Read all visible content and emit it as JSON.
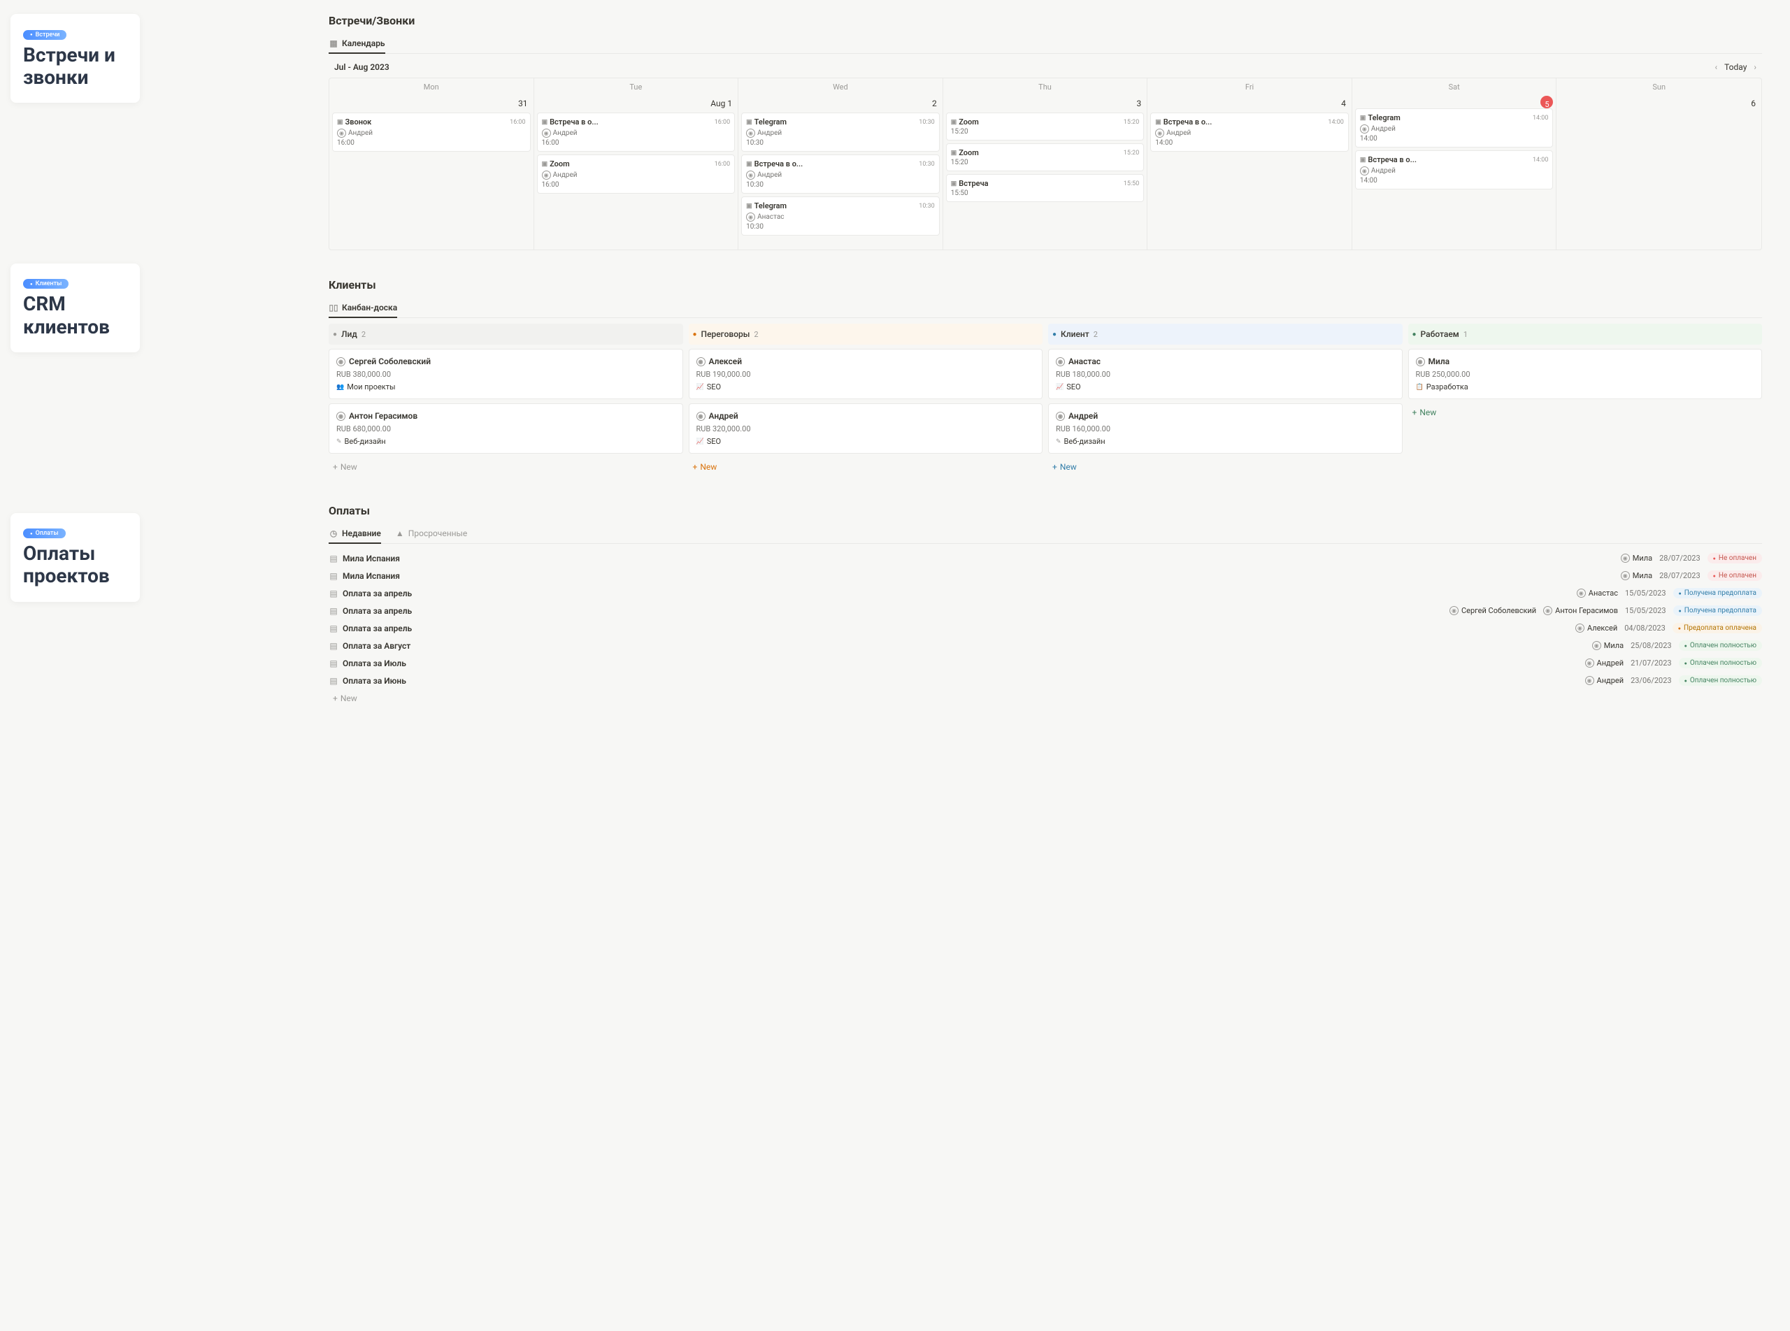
{
  "sidebar": [
    {
      "pill": "Встречи",
      "title": "Встречи и звонки"
    },
    {
      "pill": "Клиенты",
      "title": "CRM клиентов"
    },
    {
      "pill": "Оплаты",
      "title": "Оплаты проектов"
    }
  ],
  "meetings": {
    "title": "Встречи/Звонки",
    "tab": "Календарь",
    "month": "Jul - Aug 2023",
    "today": "Today",
    "days": [
      "Mon",
      "Tue",
      "Wed",
      "Thu",
      "Fri",
      "Sat",
      "Sun"
    ],
    "dates": [
      "31",
      "Aug 1",
      "2",
      "3",
      "4",
      "5",
      "6"
    ],
    "events": [
      [
        {
          "title": "Звонок",
          "topTime": "16:00",
          "person": "Андрей",
          "time": "16:00"
        }
      ],
      [
        {
          "title": "Встреча в о...",
          "topTime": "16:00",
          "person": "Андрей",
          "time": "16:00"
        },
        {
          "title": "Zoom",
          "topTime": "16:00",
          "person": "Андрей",
          "time": "16:00"
        }
      ],
      [
        {
          "title": "Telegram",
          "topTime": "10:30",
          "person": "Андрей",
          "time": "10:30"
        },
        {
          "title": "Встреча в о...",
          "topTime": "10:30",
          "person": "Андрей",
          "time": "10:30"
        },
        {
          "title": "Telegram",
          "topTime": "10:30",
          "person": "Анастас",
          "time": "10:30"
        }
      ],
      [
        {
          "title": "Zoom",
          "topTime": "15:20",
          "time": "15:20"
        },
        {
          "title": "Zoom",
          "topTime": "15:20",
          "time": "15:20"
        },
        {
          "title": "Встреча",
          "topTime": "15:50",
          "time": "15:50"
        }
      ],
      [
        {
          "title": "Встреча в о...",
          "topTime": "14:00",
          "person": "Андрей",
          "time": "14:00"
        }
      ],
      [
        {
          "title": "Telegram",
          "topTime": "14:00",
          "person": "Андрей",
          "time": "14:00"
        },
        {
          "title": "Встреча в о...",
          "topTime": "14:00",
          "person": "Андрей",
          "time": "14:00"
        }
      ],
      []
    ]
  },
  "clients": {
    "title": "Клиенты",
    "tab": "Канбан-доска",
    "columns": [
      {
        "label": "Лид",
        "count": "2",
        "class": "lead",
        "dot": "gray",
        "new": "",
        "cards": [
          {
            "name": "Сергей Соболевский",
            "price": "RUB 380,000.00",
            "tag": "Мои проекты",
            "tagIcon": "👥"
          },
          {
            "name": "Антон Герасимов",
            "price": "RUB 680,000.00",
            "tag": "Веб-дизайн",
            "tagIcon": "✎"
          }
        ]
      },
      {
        "label": "Переговоры",
        "count": "2",
        "class": "nego",
        "dot": "orange",
        "new": "orange",
        "cards": [
          {
            "name": "Алексей",
            "price": "RUB 190,000.00",
            "tag": "SEO",
            "tagIcon": "📈"
          },
          {
            "name": "Андрей",
            "price": "RUB 320,000.00",
            "tag": "SEO",
            "tagIcon": "📈"
          }
        ]
      },
      {
        "label": "Клиент",
        "count": "2",
        "class": "client",
        "dot": "blue",
        "new": "blue",
        "cards": [
          {
            "name": "Анастас",
            "price": "RUB 180,000.00",
            "tag": "SEO",
            "tagIcon": "📈"
          },
          {
            "name": "Андрей",
            "price": "RUB 160,000.00",
            "tag": "Веб-дизайн",
            "tagIcon": "✎"
          }
        ]
      },
      {
        "label": "Работаем",
        "count": "1",
        "class": "work",
        "dot": "green",
        "new": "green",
        "cards": [
          {
            "name": "Мила",
            "price": "RUB 250,000.00",
            "tag": "Разработка",
            "tagIcon": "📋"
          }
        ]
      }
    ],
    "newLabel": "New"
  },
  "payments": {
    "title": "Оплаты",
    "tabs": [
      {
        "label": "Недавние",
        "active": true
      },
      {
        "label": "Просроченные",
        "active": false
      }
    ],
    "rows": [
      {
        "title": "Мила Испания",
        "persons": [
          "Мила"
        ],
        "date": "28/07/2023",
        "status": "Не оплачен",
        "statusClass": "unpaid"
      },
      {
        "title": "Мила Испания",
        "persons": [
          "Мила"
        ],
        "date": "28/07/2023",
        "status": "Не оплачен",
        "statusClass": "unpaid"
      },
      {
        "title": "Оплата за апрель",
        "persons": [
          "Анастас"
        ],
        "date": "15/05/2023",
        "status": "Получена предоплата",
        "statusClass": "prepay"
      },
      {
        "title": "Оплата за апрель",
        "persons": [
          "Сергей Соболевский",
          "Антон Герасимов"
        ],
        "date": "15/05/2023",
        "status": "Получена предоплата",
        "statusClass": "prepay"
      },
      {
        "title": "Оплата за апрель",
        "persons": [
          "Алексей"
        ],
        "date": "04/08/2023",
        "status": "Предоплата оплачена",
        "statusClass": "prepaid"
      },
      {
        "title": "Оплата за Август",
        "persons": [
          "Мила"
        ],
        "date": "25/08/2023",
        "status": "Оплачен полностью",
        "statusClass": "paid"
      },
      {
        "title": "Оплата за Июль",
        "persons": [
          "Андрей"
        ],
        "date": "21/07/2023",
        "status": "Оплачен полностью",
        "statusClass": "paid"
      },
      {
        "title": "Оплата за Июнь",
        "persons": [
          "Андрей"
        ],
        "date": "23/06/2023",
        "status": "Оплачен полностью",
        "statusClass": "paid"
      }
    ],
    "newLabel": "New"
  }
}
